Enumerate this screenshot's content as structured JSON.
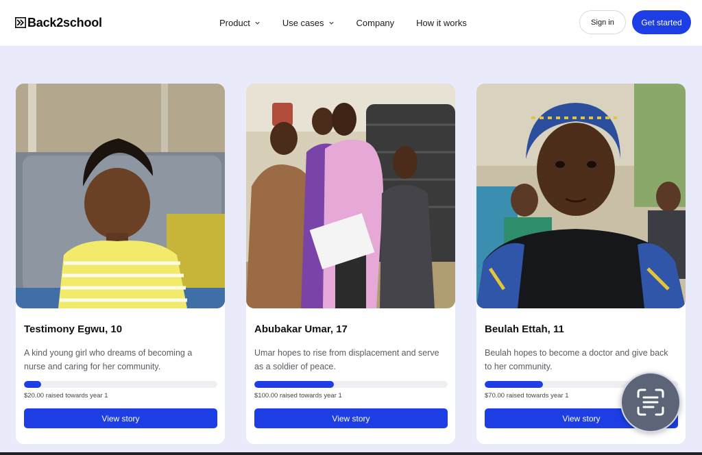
{
  "brand": {
    "name": "Back2school",
    "accent": "#1c3ee4"
  },
  "nav": {
    "items": [
      {
        "label": "Product",
        "dropdown": true
      },
      {
        "label": "Use cases",
        "dropdown": true
      },
      {
        "label": "Company",
        "dropdown": false
      },
      {
        "label": "How it works",
        "dropdown": false
      }
    ],
    "sign_in": "Sign in",
    "get_started": "Get started"
  },
  "cards": [
    {
      "name": "Testimony Egwu, 10",
      "description": "A kind young girl who dreams of becoming a nurse and caring for her community.",
      "progress": 0.09,
      "raised": "$20.00 raised towards year 1",
      "button": "View story"
    },
    {
      "name": "Abubakar Umar, 17",
      "description": "Umar hopes to rise from displacement and serve as a soldier of peace.",
      "progress": 0.41,
      "raised": "$100.00 raised towards year 1",
      "button": "View story"
    },
    {
      "name": "Beulah Ettah, 11",
      "description": "Beulah hopes to become a doctor and give back to her community.",
      "progress": 0.3,
      "raised": "$70.00 raised towards year 1",
      "button": "View story"
    }
  ],
  "icons": {
    "logo": "double-chevron-logo-icon",
    "dropdown": "chevron-down-icon",
    "scan": "scan-text-icon"
  }
}
